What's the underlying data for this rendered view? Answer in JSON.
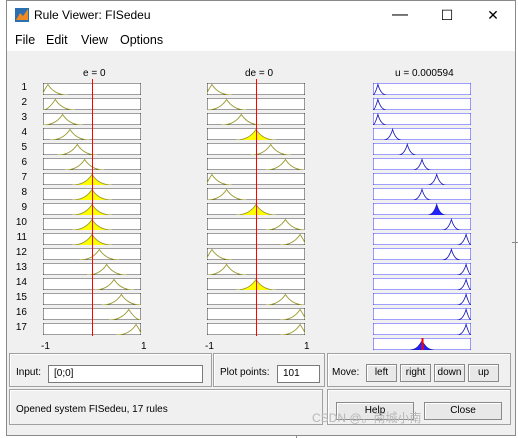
{
  "window": {
    "title": "Rule Viewer: FISedeu"
  },
  "titlebar_buttons": {
    "minimize": "—",
    "maximize": "☐",
    "close": "✕"
  },
  "menu": [
    "File",
    "Edit",
    "View",
    "Options"
  ],
  "variables": [
    {
      "title": "e = 0",
      "range_min": "-1",
      "range_max": "1"
    },
    {
      "title": "de = 0",
      "range_min": "-1",
      "range_max": "1"
    },
    {
      "title": "u = 0.000594"
    }
  ],
  "rules": [
    "1",
    "2",
    "3",
    "4",
    "5",
    "6",
    "7",
    "8",
    "9",
    "10",
    "11",
    "12",
    "13",
    "14",
    "15",
    "16",
    "17"
  ],
  "input_marker_fraction": 0.5,
  "colors": {
    "input_line": "#ff0000",
    "mf_line": "#9a9a30",
    "mf_fill": "#ffff00",
    "out_line": "#1c1cc0",
    "out_fill": "#2222ff",
    "output_box": "#0000ff"
  },
  "input_panel": {
    "label": "Input:",
    "value": "[0;0]"
  },
  "plot_points": {
    "label": "Plot points:",
    "value": "101"
  },
  "move": {
    "label": "Move:",
    "left": "left",
    "right": "right",
    "down": "down",
    "up": "up"
  },
  "status_text": "Opened system FISedeu, 17 rules",
  "help_label": "Help",
  "close_label": "Close",
  "watermark": "CSDN @。南城小南"
}
